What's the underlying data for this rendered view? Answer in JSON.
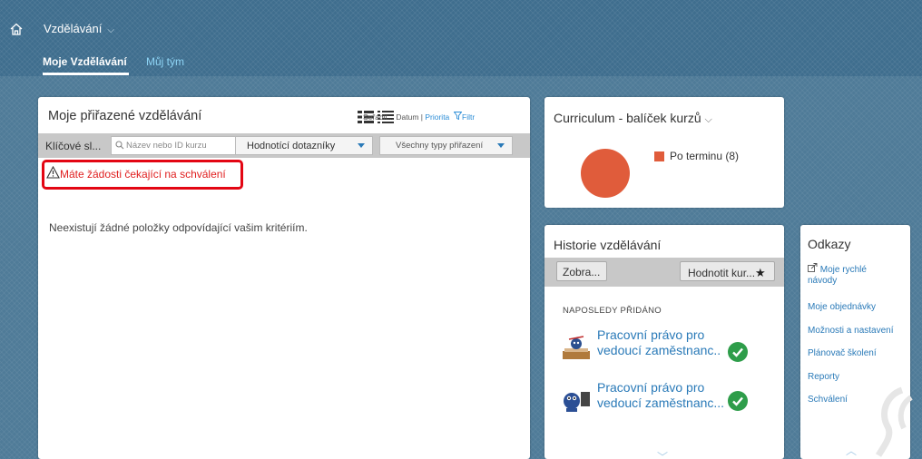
{
  "header": {
    "app_title": "Vzdělávání",
    "tabs": [
      {
        "label": "Moje Vzdělávání",
        "active": true
      },
      {
        "label": "Můj tým",
        "active": false
      }
    ]
  },
  "assigned": {
    "title": "Moje přiřazené vzdělávání",
    "sort_label": "Seřadit... Datum |",
    "sort_priority": "Priorita",
    "filter_label": "Filtr",
    "keyword_label": "Klíčové sl...",
    "search_placeholder": "Název nebo ID kurzu",
    "dropdown_surveys": "Hodnotící dotazníky",
    "dropdown_types": "Všechny typy přiřazení",
    "warning": "Máte žádosti čekající na schválení",
    "empty_message": "Neexistují žádné položky odpovídající vašim kritériím."
  },
  "curriculum": {
    "title": "Curriculum - balíček kurzů",
    "legend": "Po terminu (8)"
  },
  "chart_data": {
    "type": "pie",
    "categories": [
      "Po terminu"
    ],
    "values": [
      8
    ],
    "colors": [
      "#e05c3b"
    ]
  },
  "history": {
    "title": "Historie vzdělávání",
    "btn_show": "Zobra...",
    "btn_rate": "Hodnotit kur...",
    "recent_label": "NAPOSLEDY PŘIDÁNO",
    "courses": [
      {
        "line1": "Pracovní právo pro",
        "line2": "vedoucí zaměstnanc..",
        "icon": "check-complete-icon"
      },
      {
        "line1": "Pracovní právo pro",
        "line2": "vedoucí zaměstnanc...",
        "icon": "check-complete-icon"
      }
    ]
  },
  "links": {
    "title": "Odkazy",
    "items": [
      "Moje rychlé",
      "návody",
      "Moje objednávky",
      "Možnosti a nastavení",
      "Plánovač školení",
      "Reporty",
      "Schválení"
    ]
  },
  "colors": {
    "header": "#3f6e8e",
    "link": "#2a7ab8",
    "warning": "#e02020",
    "overdue": "#e05c3b",
    "complete": "#2e9d4a"
  }
}
